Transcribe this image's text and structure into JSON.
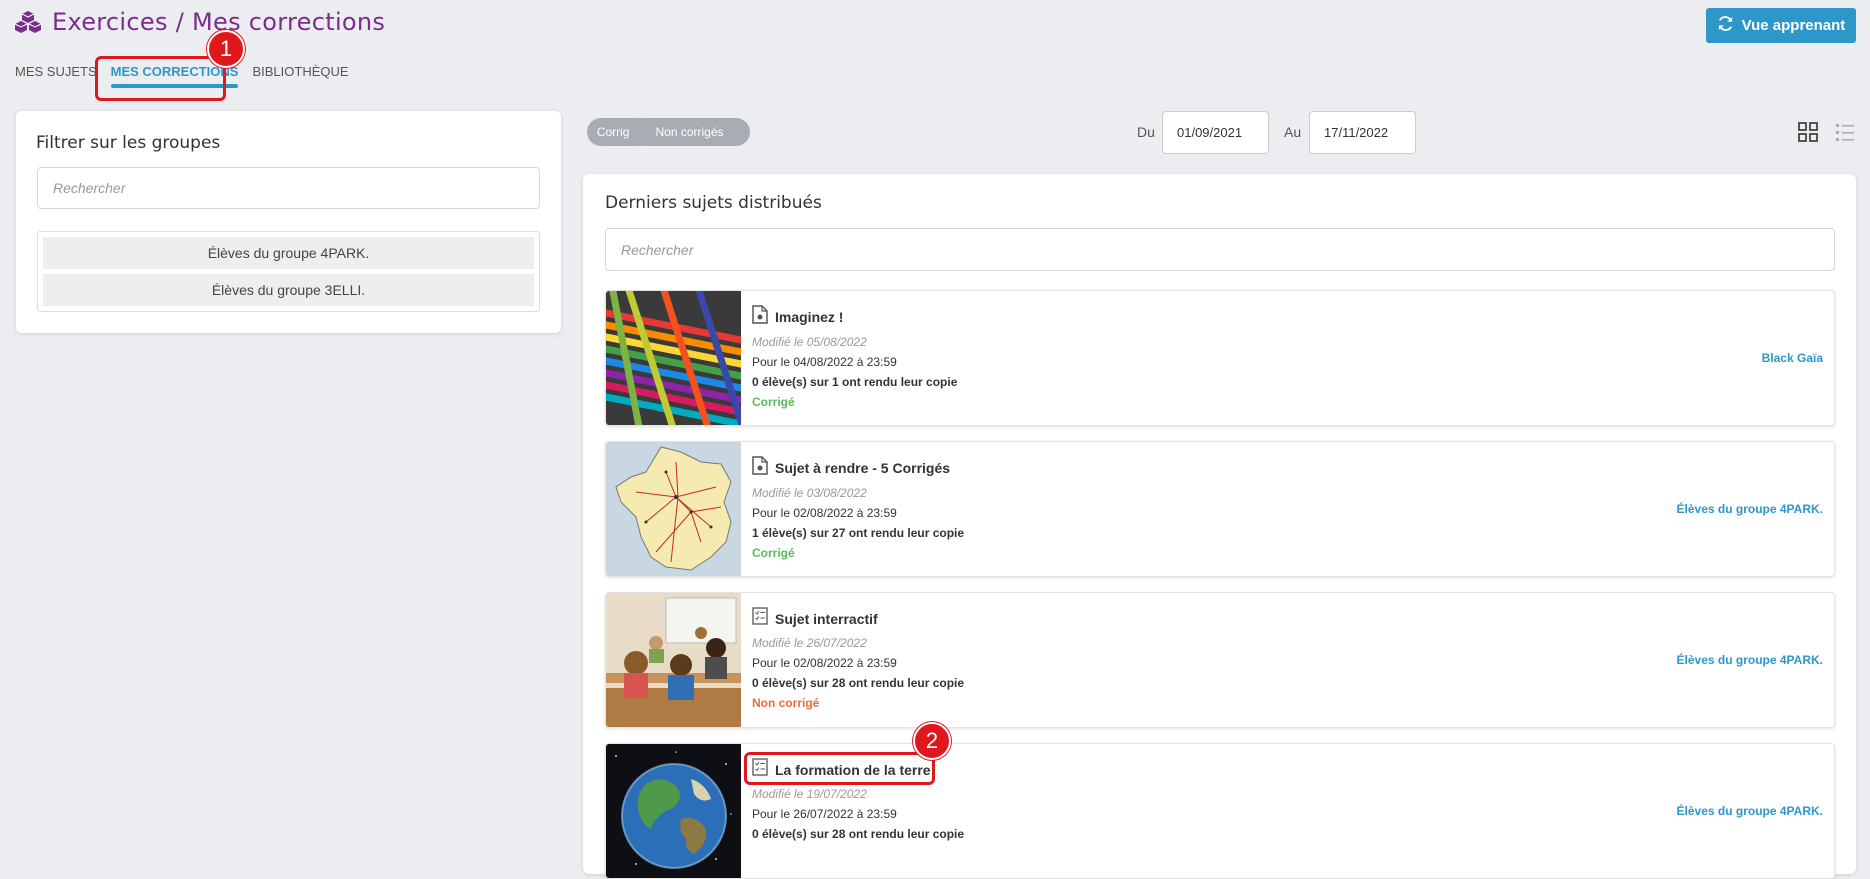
{
  "header": {
    "title": "Exercices / Mes corrections",
    "vue_button": "Vue apprenant"
  },
  "tabs": [
    {
      "label": "MES SUJETS",
      "active": false
    },
    {
      "label": "MES CORRECTIONS",
      "active": true
    },
    {
      "label": "BIBLIOTHÈQUE",
      "active": false
    }
  ],
  "annotations": [
    "1",
    "2"
  ],
  "left_panel": {
    "title": "Filtrer sur les groupes",
    "search_placeholder": "Rechercher",
    "groups": [
      "Élèves du groupe 4PARK.",
      "Élèves du groupe 3ELLI."
    ]
  },
  "filters": {
    "pills": [
      "Corrigés",
      "Non corrigés"
    ],
    "from_label": "Du",
    "from_date": "01/09/2021",
    "to_label": "Au",
    "to_date": "17/11/2022"
  },
  "main": {
    "title": "Derniers sujets distribués",
    "search_placeholder": "Rechercher",
    "items": [
      {
        "title": "Imaginez !",
        "modified": "Modifié le 05/08/2022",
        "due": "Pour le 04/08/2022 à 23:59",
        "submitted": "0 élève(s) sur 1 ont rendu leur copie",
        "status": "Corrigé",
        "assignee": "Black Gaïa",
        "icon": "document-icon"
      },
      {
        "title": "Sujet à rendre - 5 Corrigés",
        "modified": "Modifié le 03/08/2022",
        "due": "Pour le 02/08/2022 à 23:59",
        "submitted": "1 élève(s) sur 27 ont rendu leur copie",
        "status": "Corrigé",
        "assignee": "Élèves du groupe 4PARK.",
        "icon": "document-icon"
      },
      {
        "title": "Sujet interractif",
        "modified": "Modifié le 26/07/2022",
        "due": "Pour le 02/08/2022 à 23:59",
        "submitted": "0 élève(s) sur 28 ont rendu leur copie",
        "status": "Non corrigé",
        "assignee": "Élèves du groupe 4PARK.",
        "icon": "checklist-icon"
      },
      {
        "title": "La formation de la terre",
        "modified": "Modifié le 19/07/2022",
        "due": "Pour le 26/07/2022 à 23:59",
        "submitted": "0 élève(s) sur 28 ont rendu leur copie",
        "status": "",
        "assignee": "Élèves du groupe 4PARK.",
        "icon": "checklist-icon"
      }
    ]
  },
  "colors": {
    "accent": "#2d97c9",
    "title_purple": "#7b2d8b",
    "status_corrige": "#5cb85c",
    "status_non_corrige": "#f0693a",
    "annotation_red": "#e0181e"
  }
}
